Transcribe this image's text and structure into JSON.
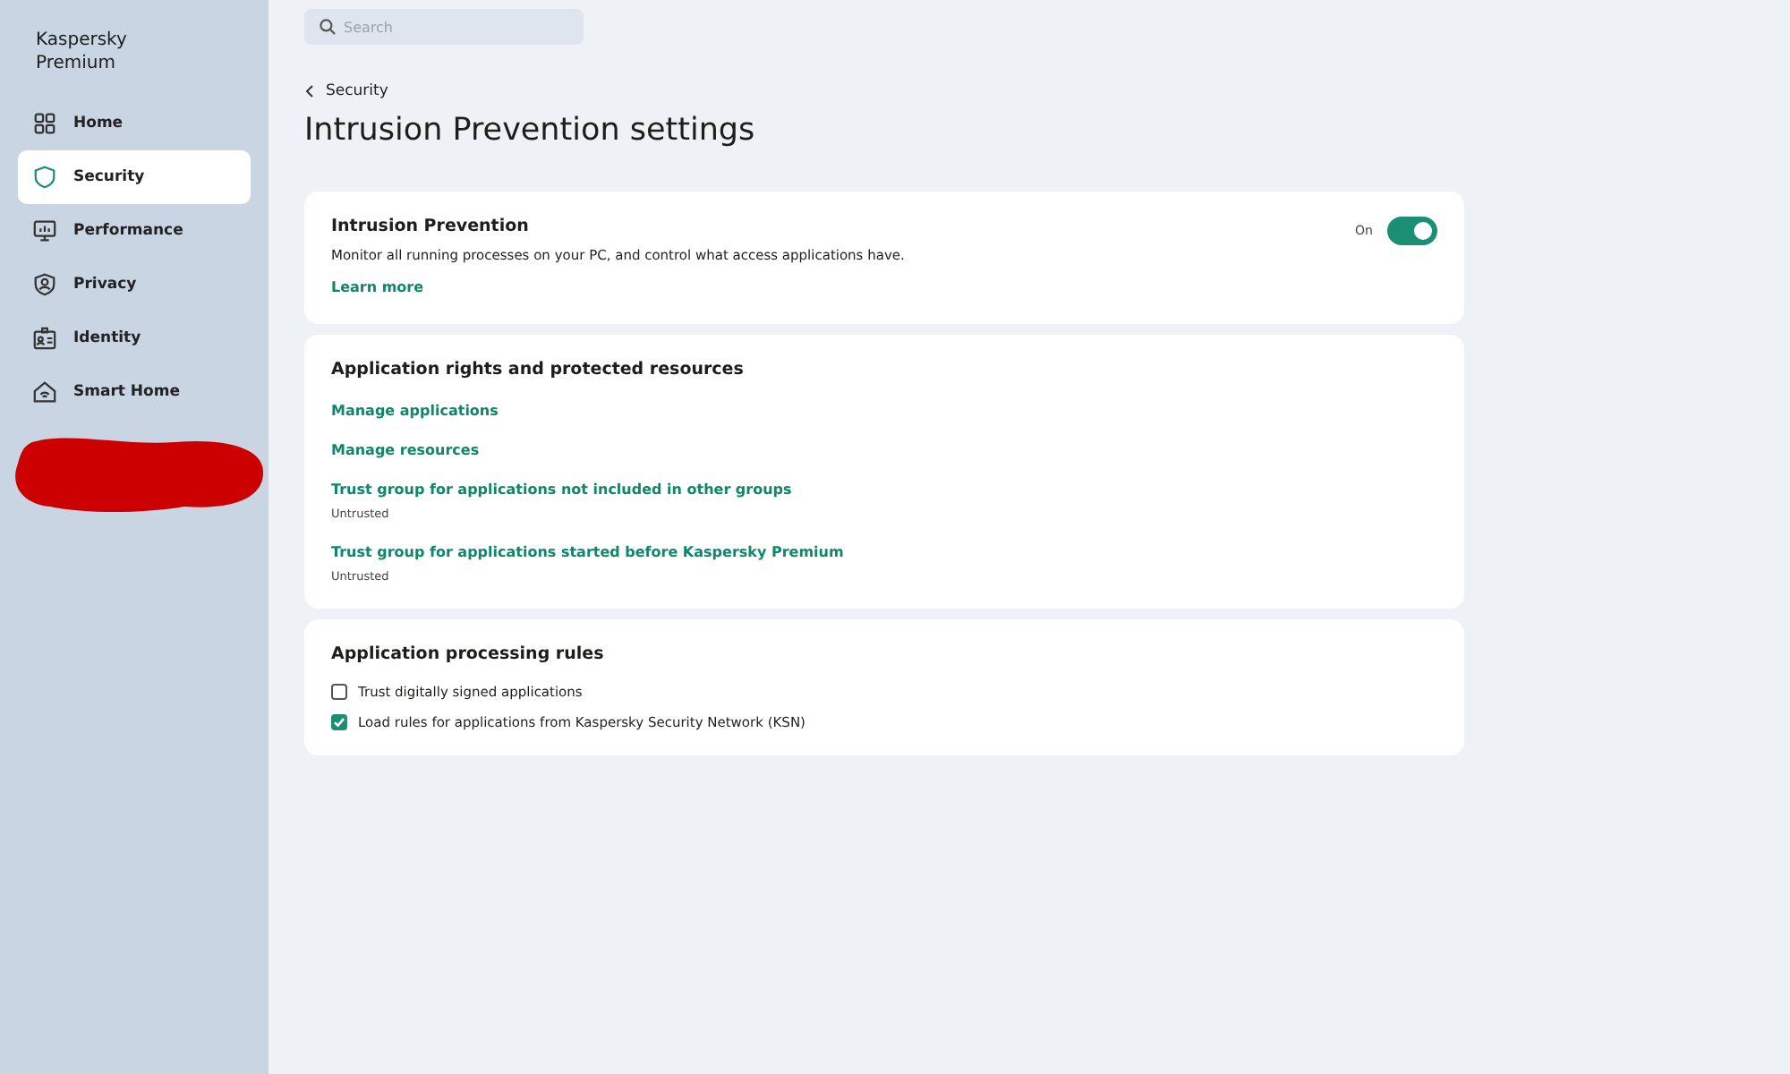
{
  "app": {
    "name": "Kaspersky Premium"
  },
  "sidebar": {
    "items": [
      {
        "label": "Home",
        "selected": false
      },
      {
        "label": "Security",
        "selected": true
      },
      {
        "label": "Performance",
        "selected": false
      },
      {
        "label": "Privacy",
        "selected": false
      },
      {
        "label": "Identity",
        "selected": false
      },
      {
        "label": "Smart Home",
        "selected": false
      }
    ]
  },
  "search": {
    "placeholder": "Search"
  },
  "breadcrumb": {
    "label": "Security"
  },
  "page_title": "Intrusion Prevention settings",
  "cards": [
    {
      "kind": "toggle",
      "title": "Intrusion Prevention",
      "description": "Monitor all running processes on your PC, and control what access applications have.",
      "link": "Learn more",
      "toggle_label": "On",
      "on": true
    },
    {
      "kind": "links",
      "title": "Application rights and protected resources",
      "links": [
        {
          "label": "Manage applications"
        },
        {
          "label": "Manage resources"
        },
        {
          "label": "Trust group for applications not included in other groups",
          "value": "Untrusted"
        },
        {
          "label": "Trust group for applications started before Kaspersky Premium",
          "value": "Untrusted"
        }
      ]
    },
    {
      "kind": "checks",
      "title": "Application processing rules",
      "options": [
        {
          "label": "Trust digitally signed applications",
          "checked": false
        },
        {
          "label": "Load rules for applications from Kaspersky Security Network (KSN)",
          "checked": true
        }
      ]
    }
  ]
}
